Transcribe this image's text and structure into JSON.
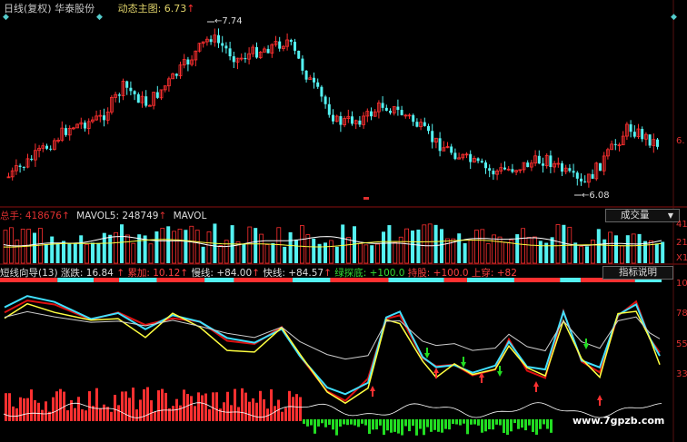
{
  "header": {
    "title": "日线(复权) 华泰股份",
    "subtitle": "动态主图: 6.73",
    "arrow_up": "↑",
    "diamond": "◆"
  },
  "price_panel": {
    "high_annotation": "←7.74",
    "low_annotation": "←6.08",
    "right_axis_label": "6."
  },
  "volume_panel": {
    "total_label": "总手: 418676",
    "mavol5_label": "MAVOL5: 248749",
    "mavol_label": "MAVOL",
    "selector": "成交量",
    "selector_arrow": "▼",
    "axis_labels": [
      "41",
      "21",
      "X1"
    ]
  },
  "indicator_panel": {
    "name": "短线向导(13)",
    "items": [
      {
        "text": "涨跌: 16.84",
        "tone": "w"
      },
      {
        "text": "累加: 10.12",
        "tone": "r"
      },
      {
        "text": "慢线: +84.00",
        "tone": "w"
      },
      {
        "text": "快线: +84.57",
        "tone": "w"
      },
      {
        "text": "绿探底: +100.0",
        "tone": "g"
      },
      {
        "text": "持股: +100.0",
        "tone": "r"
      },
      {
        "text": "上穿: +82",
        "tone": "r"
      }
    ],
    "button": "指标说明",
    "axis_labels": [
      "10",
      "78",
      "55",
      "33"
    ]
  },
  "watermark": "www.7gpzb.com",
  "colors": {
    "up": "#ff3030",
    "down": "#54f2f2",
    "yellow": "#ffff40",
    "cyan_line": "#40e0ff",
    "red_line": "#dd1111",
    "green": "#22dd22",
    "bg": "#000000"
  },
  "chart_data": {
    "type": "candlestick",
    "high": 7.74,
    "low": 6.08,
    "last": 6.73
  }
}
